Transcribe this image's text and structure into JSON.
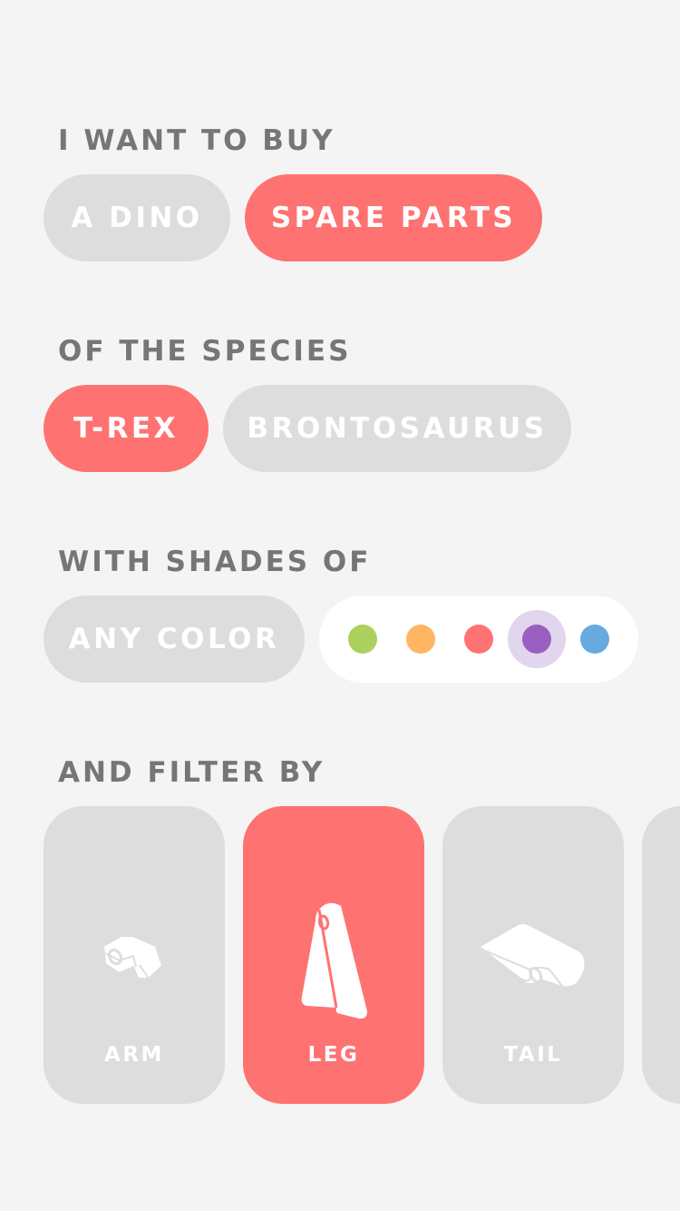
{
  "sections": {
    "buy": {
      "label": "I WANT TO BUY",
      "options": [
        {
          "label": "A DINO",
          "selected": false
        },
        {
          "label": "SPARE PARTS",
          "selected": true
        }
      ]
    },
    "species": {
      "label": "OF THE SPECIES",
      "options": [
        {
          "label": "T-REX",
          "selected": true
        },
        {
          "label": "BRONTOSAURUS",
          "selected": false
        }
      ]
    },
    "shades": {
      "label": "WITH SHADES OF",
      "any_color_label": "ANY COLOR",
      "any_color_selected": false,
      "swatches": [
        {
          "name": "green",
          "color": "#acd05c",
          "selected": false
        },
        {
          "name": "orange",
          "color": "#ffb561",
          "selected": false
        },
        {
          "name": "red",
          "color": "#ff7272",
          "selected": false
        },
        {
          "name": "purple",
          "color": "#9a5fc1",
          "selected": true
        },
        {
          "name": "blue",
          "color": "#66aadf",
          "selected": false
        }
      ]
    },
    "filter": {
      "label": "AND FILTER BY",
      "parts": [
        {
          "label": "ARM",
          "icon": "arm-part-icon",
          "selected": false
        },
        {
          "label": "LEG",
          "icon": "leg-part-icon",
          "selected": true
        },
        {
          "label": "TAIL",
          "icon": "tail-part-icon",
          "selected": false
        }
      ]
    }
  },
  "colors": {
    "accent": "#ff7272",
    "inactive_pill": "#dddddd",
    "label_text": "#767676",
    "background": "#f4f4f4"
  }
}
